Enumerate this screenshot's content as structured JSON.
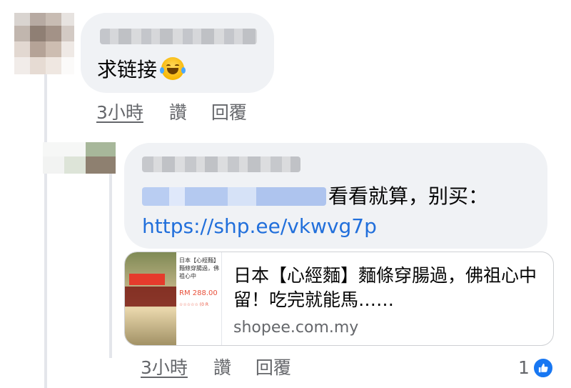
{
  "comment_1": {
    "text": "求链接",
    "emoji": "tears-of-joy-emoji",
    "time": "3小時",
    "like_label": "讚",
    "reply_label": "回覆"
  },
  "comment_2": {
    "text": "看看就算，别买：",
    "link": "https://shp.ee/vkwvg7p",
    "preview": {
      "title": "日本【心經麵】麵條穿腸過，佛祖心中留！吃完就能馬……",
      "domain": "shopee.com.my",
      "thumb_title": "日本【心經麵】麵條穿腸過，佛祖心中",
      "thumb_price": "RM 288.00",
      "thumb_rating": "☆☆☆☆☆ (0 R"
    },
    "time": "3小時",
    "like_label": "讚",
    "reply_label": "回覆",
    "reaction_count": "1",
    "reaction_icon": "like-icon"
  },
  "colors": {
    "bubble": "#f0f2f5",
    "link": "#216fdb",
    "meta": "#65676b",
    "like": "#1877f2"
  }
}
